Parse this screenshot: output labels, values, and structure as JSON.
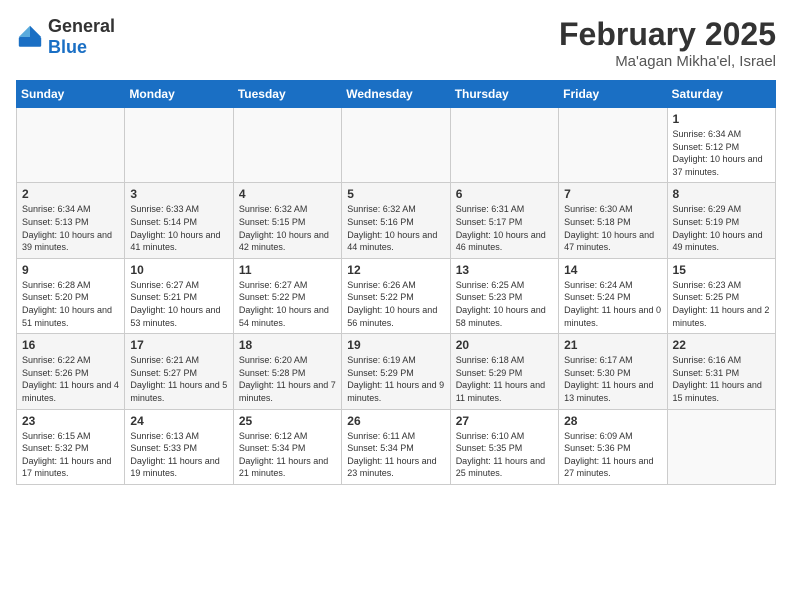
{
  "logo": {
    "general": "General",
    "blue": "Blue"
  },
  "title": "February 2025",
  "subtitle": "Ma'agan Mikha'el, Israel",
  "days_of_week": [
    "Sunday",
    "Monday",
    "Tuesday",
    "Wednesday",
    "Thursday",
    "Friday",
    "Saturday"
  ],
  "weeks": [
    [
      {
        "day": "",
        "info": ""
      },
      {
        "day": "",
        "info": ""
      },
      {
        "day": "",
        "info": ""
      },
      {
        "day": "",
        "info": ""
      },
      {
        "day": "",
        "info": ""
      },
      {
        "day": "",
        "info": ""
      },
      {
        "day": "1",
        "info": "Sunrise: 6:34 AM\nSunset: 5:12 PM\nDaylight: 10 hours and 37 minutes."
      }
    ],
    [
      {
        "day": "2",
        "info": "Sunrise: 6:34 AM\nSunset: 5:13 PM\nDaylight: 10 hours and 39 minutes."
      },
      {
        "day": "3",
        "info": "Sunrise: 6:33 AM\nSunset: 5:14 PM\nDaylight: 10 hours and 41 minutes."
      },
      {
        "day": "4",
        "info": "Sunrise: 6:32 AM\nSunset: 5:15 PM\nDaylight: 10 hours and 42 minutes."
      },
      {
        "day": "5",
        "info": "Sunrise: 6:32 AM\nSunset: 5:16 PM\nDaylight: 10 hours and 44 minutes."
      },
      {
        "day": "6",
        "info": "Sunrise: 6:31 AM\nSunset: 5:17 PM\nDaylight: 10 hours and 46 minutes."
      },
      {
        "day": "7",
        "info": "Sunrise: 6:30 AM\nSunset: 5:18 PM\nDaylight: 10 hours and 47 minutes."
      },
      {
        "day": "8",
        "info": "Sunrise: 6:29 AM\nSunset: 5:19 PM\nDaylight: 10 hours and 49 minutes."
      }
    ],
    [
      {
        "day": "9",
        "info": "Sunrise: 6:28 AM\nSunset: 5:20 PM\nDaylight: 10 hours and 51 minutes."
      },
      {
        "day": "10",
        "info": "Sunrise: 6:27 AM\nSunset: 5:21 PM\nDaylight: 10 hours and 53 minutes."
      },
      {
        "day": "11",
        "info": "Sunrise: 6:27 AM\nSunset: 5:22 PM\nDaylight: 10 hours and 54 minutes."
      },
      {
        "day": "12",
        "info": "Sunrise: 6:26 AM\nSunset: 5:22 PM\nDaylight: 10 hours and 56 minutes."
      },
      {
        "day": "13",
        "info": "Sunrise: 6:25 AM\nSunset: 5:23 PM\nDaylight: 10 hours and 58 minutes."
      },
      {
        "day": "14",
        "info": "Sunrise: 6:24 AM\nSunset: 5:24 PM\nDaylight: 11 hours and 0 minutes."
      },
      {
        "day": "15",
        "info": "Sunrise: 6:23 AM\nSunset: 5:25 PM\nDaylight: 11 hours and 2 minutes."
      }
    ],
    [
      {
        "day": "16",
        "info": "Sunrise: 6:22 AM\nSunset: 5:26 PM\nDaylight: 11 hours and 4 minutes."
      },
      {
        "day": "17",
        "info": "Sunrise: 6:21 AM\nSunset: 5:27 PM\nDaylight: 11 hours and 5 minutes."
      },
      {
        "day": "18",
        "info": "Sunrise: 6:20 AM\nSunset: 5:28 PM\nDaylight: 11 hours and 7 minutes."
      },
      {
        "day": "19",
        "info": "Sunrise: 6:19 AM\nSunset: 5:29 PM\nDaylight: 11 hours and 9 minutes."
      },
      {
        "day": "20",
        "info": "Sunrise: 6:18 AM\nSunset: 5:29 PM\nDaylight: 11 hours and 11 minutes."
      },
      {
        "day": "21",
        "info": "Sunrise: 6:17 AM\nSunset: 5:30 PM\nDaylight: 11 hours and 13 minutes."
      },
      {
        "day": "22",
        "info": "Sunrise: 6:16 AM\nSunset: 5:31 PM\nDaylight: 11 hours and 15 minutes."
      }
    ],
    [
      {
        "day": "23",
        "info": "Sunrise: 6:15 AM\nSunset: 5:32 PM\nDaylight: 11 hours and 17 minutes."
      },
      {
        "day": "24",
        "info": "Sunrise: 6:13 AM\nSunset: 5:33 PM\nDaylight: 11 hours and 19 minutes."
      },
      {
        "day": "25",
        "info": "Sunrise: 6:12 AM\nSunset: 5:34 PM\nDaylight: 11 hours and 21 minutes."
      },
      {
        "day": "26",
        "info": "Sunrise: 6:11 AM\nSunset: 5:34 PM\nDaylight: 11 hours and 23 minutes."
      },
      {
        "day": "27",
        "info": "Sunrise: 6:10 AM\nSunset: 5:35 PM\nDaylight: 11 hours and 25 minutes."
      },
      {
        "day": "28",
        "info": "Sunrise: 6:09 AM\nSunset: 5:36 PM\nDaylight: 11 hours and 27 minutes."
      },
      {
        "day": "",
        "info": ""
      }
    ]
  ]
}
